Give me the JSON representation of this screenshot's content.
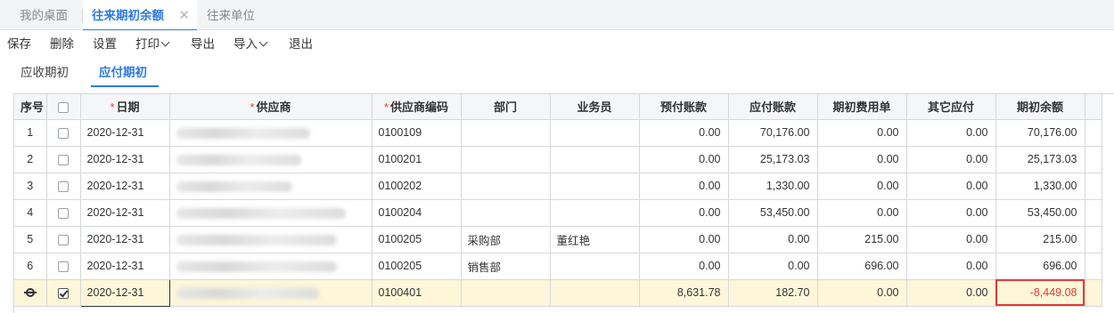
{
  "tabs": [
    {
      "label": "我的桌面",
      "active": false
    },
    {
      "label": "往来期初余额",
      "active": true,
      "close": "✕"
    },
    {
      "label": "往来单位",
      "active": false
    }
  ],
  "toolbar": {
    "save": "保存",
    "delete": "删除",
    "settings": "设置",
    "print": "打印",
    "export": "导出",
    "import": "导入",
    "exit": "退出"
  },
  "subtabs": [
    {
      "label": "应收期初",
      "active": false
    },
    {
      "label": "应付期初",
      "active": true
    }
  ],
  "table": {
    "headers": {
      "seq": "序号",
      "date": "日期",
      "supplier": "供应商",
      "supplier_code": "供应商编码",
      "dept": "部门",
      "salesman": "业务员",
      "prepaid": "预付账款",
      "payable": "应付账款",
      "fee": "期初费用单",
      "other": "其它应付",
      "balance": "期初余额"
    },
    "required_mark": "*",
    "rows": [
      {
        "seq": "1",
        "checked": false,
        "date": "2020-12-31",
        "code": "0100109",
        "dept": "",
        "salesman": "",
        "prepaid": "0.00",
        "payable": "70,176.00",
        "fee": "0.00",
        "other": "0.00",
        "balance": "70,176.00"
      },
      {
        "seq": "2",
        "checked": false,
        "date": "2020-12-31",
        "code": "0100201",
        "dept": "",
        "salesman": "",
        "prepaid": "0.00",
        "payable": "25,173.03",
        "fee": "0.00",
        "other": "0.00",
        "balance": "25,173.03"
      },
      {
        "seq": "3",
        "checked": false,
        "date": "2020-12-31",
        "code": "0100202",
        "dept": "",
        "salesman": "",
        "prepaid": "0.00",
        "payable": "1,330.00",
        "fee": "0.00",
        "other": "0.00",
        "balance": "1,330.00"
      },
      {
        "seq": "4",
        "checked": false,
        "date": "2020-12-31",
        "code": "0100204",
        "dept": "",
        "salesman": "",
        "prepaid": "0.00",
        "payable": "53,450.00",
        "fee": "0.00",
        "other": "0.00",
        "balance": "53,450.00"
      },
      {
        "seq": "5",
        "checked": false,
        "date": "2020-12-31",
        "code": "0100205",
        "dept": "采购部",
        "salesman": "董红艳",
        "prepaid": "0.00",
        "payable": "0.00",
        "fee": "215.00",
        "other": "0.00",
        "balance": "215.00"
      },
      {
        "seq": "6",
        "checked": false,
        "date": "2020-12-31",
        "code": "0100205",
        "dept": "销售部",
        "salesman": "",
        "prepaid": "0.00",
        "payable": "0.00",
        "fee": "696.00",
        "other": "0.00",
        "balance": "696.00"
      },
      {
        "seq": "",
        "checked": true,
        "date": "2020-12-31",
        "code": "0100401",
        "dept": "",
        "salesman": "",
        "prepaid": "8,631.78",
        "payable": "182.70",
        "fee": "0.00",
        "other": "0.00",
        "balance": "-8,449.08",
        "selected": true,
        "highlight": true
      }
    ]
  },
  "colors": {
    "accent": "#2d7be0",
    "negative": "#e53935",
    "selected_row": "#fdf6d9"
  },
  "icons": {
    "row_settings": "gear-icon",
    "close": "close-icon",
    "dropdown": "chevron-down-icon"
  }
}
